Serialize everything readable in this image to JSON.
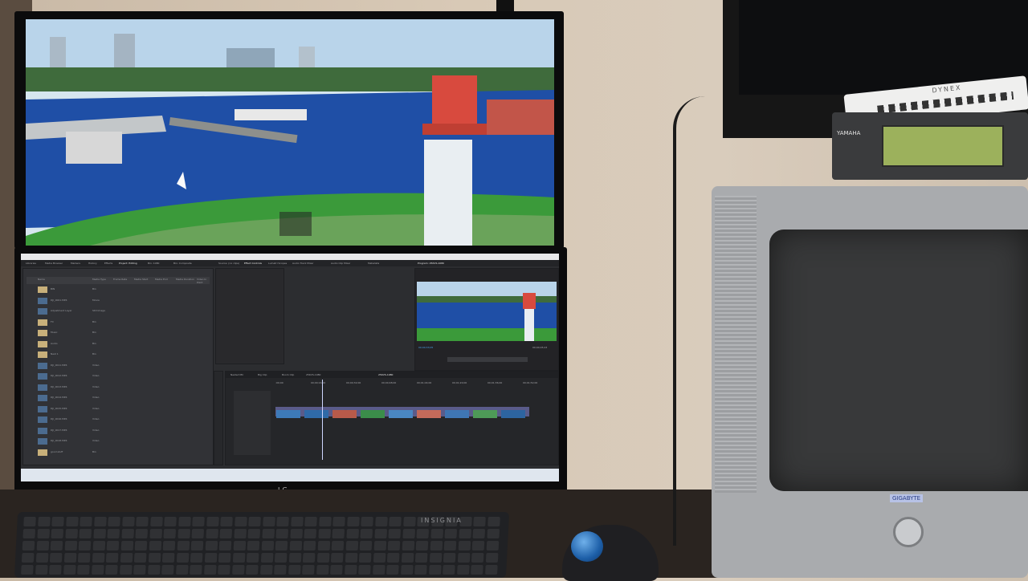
{
  "scene": {
    "description_kind": "photo",
    "monitor_brand": "LG",
    "keyboard_brand": "INSIGNIA",
    "receiver_brand": "YAMAHA",
    "box_brand": "DYNEX",
    "tv_brand": "GIGABYTE"
  },
  "premiere": {
    "menu": [
      "Libraries",
      "Media Browser",
      "Markers",
      "History",
      "Effects",
      "Project: Editing",
      "Bin: 1080",
      "Bin: Composite"
    ],
    "panel_tabs": [
      "Source: (no clips)",
      "Effect Controls",
      "Lumetri Scopes",
      "Audio Track Mixer",
      "Audio Clip Mixer",
      "Metadata"
    ],
    "program_title": "Program: 25KVS-1080",
    "timecode_left": "00;00;33;05",
    "timecode_right": "00;04;05;23",
    "seq_tabs": [
      "Nested MC",
      "Big Clip",
      "Boom Clip",
      "25KVS-1080",
      "25KVS-1080"
    ],
    "project_columns": [
      "Name",
      "Media Type",
      "Frame Rate",
      "Media Start",
      "Media End",
      "Media Duration",
      "Video In Point"
    ],
    "project_rows": [
      {
        "name": "BIN",
        "type": "Bin"
      },
      {
        "name": "DJI_0001.MP4",
        "type": "Movie"
      },
      {
        "name": "Adjustment Layer",
        "type": "Still Image"
      },
      {
        "name": "FX",
        "type": "Bin"
      },
      {
        "name": "Music",
        "type": "Bin"
      },
      {
        "name": "Audio",
        "type": "Bin"
      },
      {
        "name": "Nest 1",
        "type": "Bin"
      },
      {
        "name": "DJI_0011.MP4",
        "type": "Video"
      },
      {
        "name": "DJI_0012.MP4",
        "type": "Video"
      },
      {
        "name": "DJI_0013.MP4",
        "type": "Video"
      },
      {
        "name": "DJI_0014.MP4",
        "type": "Video"
      },
      {
        "name": "DJI_0015.MP4",
        "type": "Video"
      },
      {
        "name": "DJI_0016.MP4",
        "type": "Video"
      },
      {
        "name": "DJI_0017.MP4",
        "type": "Video"
      },
      {
        "name": "DJI_0018.MP4",
        "type": "Video"
      },
      {
        "name": "good stuff",
        "type": "Bin"
      }
    ],
    "ruler_marks": [
      ":00;00",
      "00;00;16;00",
      "00;00;32;00",
      "00;00;48;00",
      "00;01;04;00",
      "00;01;20;00",
      "00;01;36;00",
      "00;01;52;00"
    ]
  },
  "colors": {
    "accent_trackball": "#2f7fd0",
    "receiver_display": "#9cb15c",
    "premiere_bg": "#2c2d30"
  }
}
